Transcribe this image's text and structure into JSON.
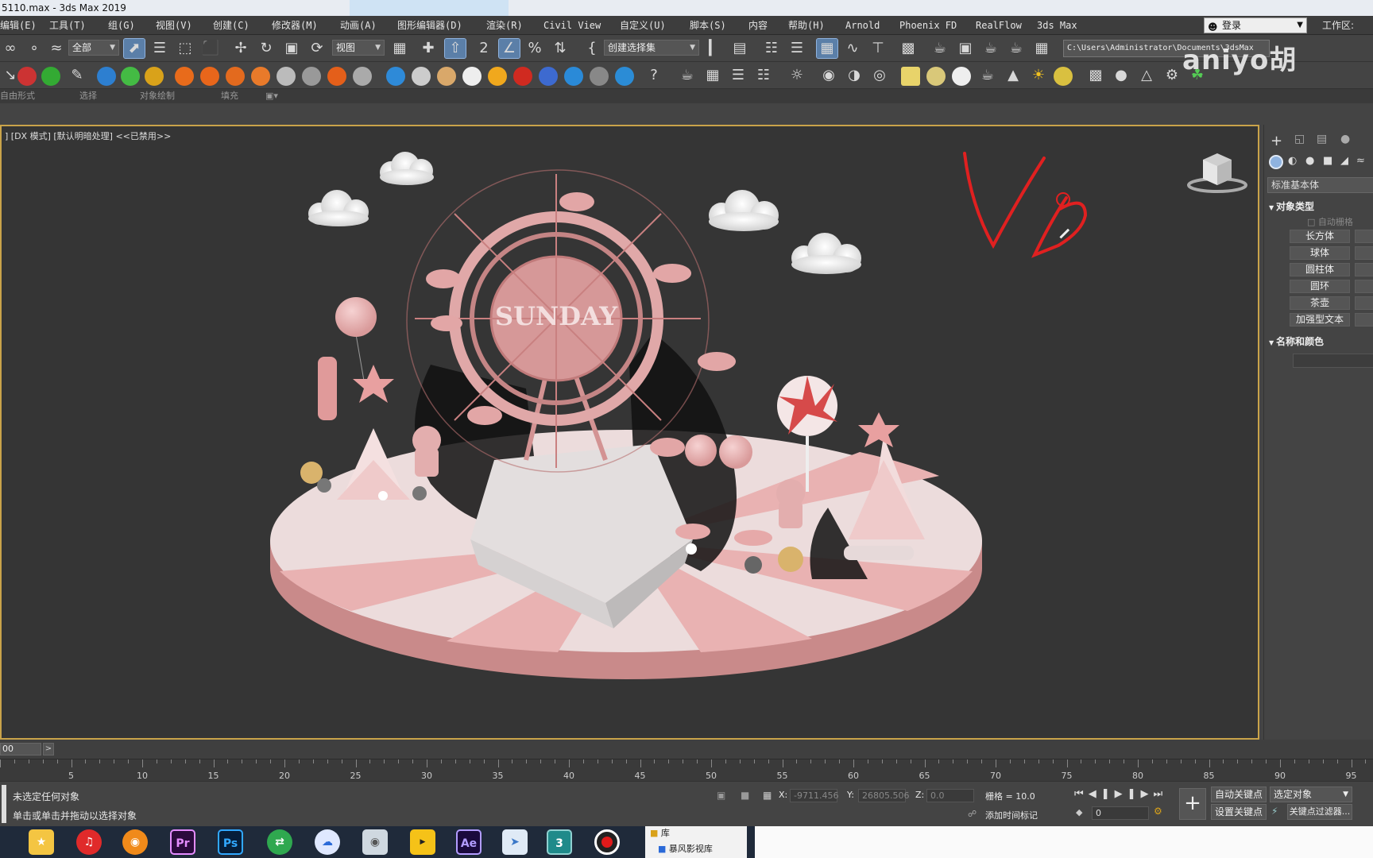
{
  "window": {
    "title": "5110.max - 3ds Max 2019"
  },
  "menu": {
    "items": [
      "编辑(E)",
      "工具(T)",
      "组(G)",
      "视图(V)",
      "创建(C)",
      "修改器(M)",
      "动画(A)",
      "图形编辑器(D)",
      "渲染(R)",
      "Civil View",
      "自定义(U)",
      "脚本(S)",
      "内容",
      "帮助(H)",
      "Arnold",
      "Phoenix FD",
      "RealFlow",
      "3ds Max"
    ],
    "login_label": "登录",
    "workspace_label": "工作区:"
  },
  "toolbar": {
    "selection_filter": "全部",
    "reference_coord": "视图",
    "named_selection": "创建选择集",
    "project_path": "C:\\Users\\Administrator\\Documents\\3dsMax"
  },
  "ribbon": {
    "labels": [
      "自由形式",
      "选择",
      "对象绘制",
      "填充"
    ]
  },
  "watermark": "aniyo胡",
  "viewport": {
    "label": "] [DX 模式] [默认明暗处理] <<已禁用>>",
    "sign_text": "SUNDAY",
    "annotation_text": "VR",
    "active_border_color": "#c9a34a"
  },
  "command_panel": {
    "category": "标准基本体",
    "section_object_type": "对象类型",
    "autogrid": "自动栅格",
    "primitives": [
      "长方体",
      "球体",
      "圆柱体",
      "圆环",
      "茶壶",
      "加强型文本"
    ],
    "section_name_color": "名称和颜色"
  },
  "timeline": {
    "frame_display": "00",
    "ticks": [
      5,
      10,
      15,
      20,
      25,
      30,
      35,
      40,
      45,
      50,
      55,
      60,
      65,
      70,
      75,
      80,
      85,
      90,
      95
    ]
  },
  "status": {
    "line1": "未选定任何对象",
    "line2": "单击或单击并拖动以选择对象",
    "x_label": "X:",
    "x_value": "-9711.456",
    "y_label": "Y:",
    "y_value": "26805.506",
    "z_label": "Z:",
    "z_value": "0.0",
    "grid": "栅格 = 10.0",
    "add_time_tag": "添加时间标记",
    "auto_key": "自动关键点",
    "set_key": "设置关键点",
    "selected_object": "选定对象",
    "key_filters": "关键点过滤器...",
    "current_frame": "0"
  },
  "taskbar": {
    "apps": [
      "Pr",
      "Ps",
      "Ae",
      "3"
    ],
    "explorer_item1": "库",
    "explorer_item2": "暴风影视库"
  }
}
